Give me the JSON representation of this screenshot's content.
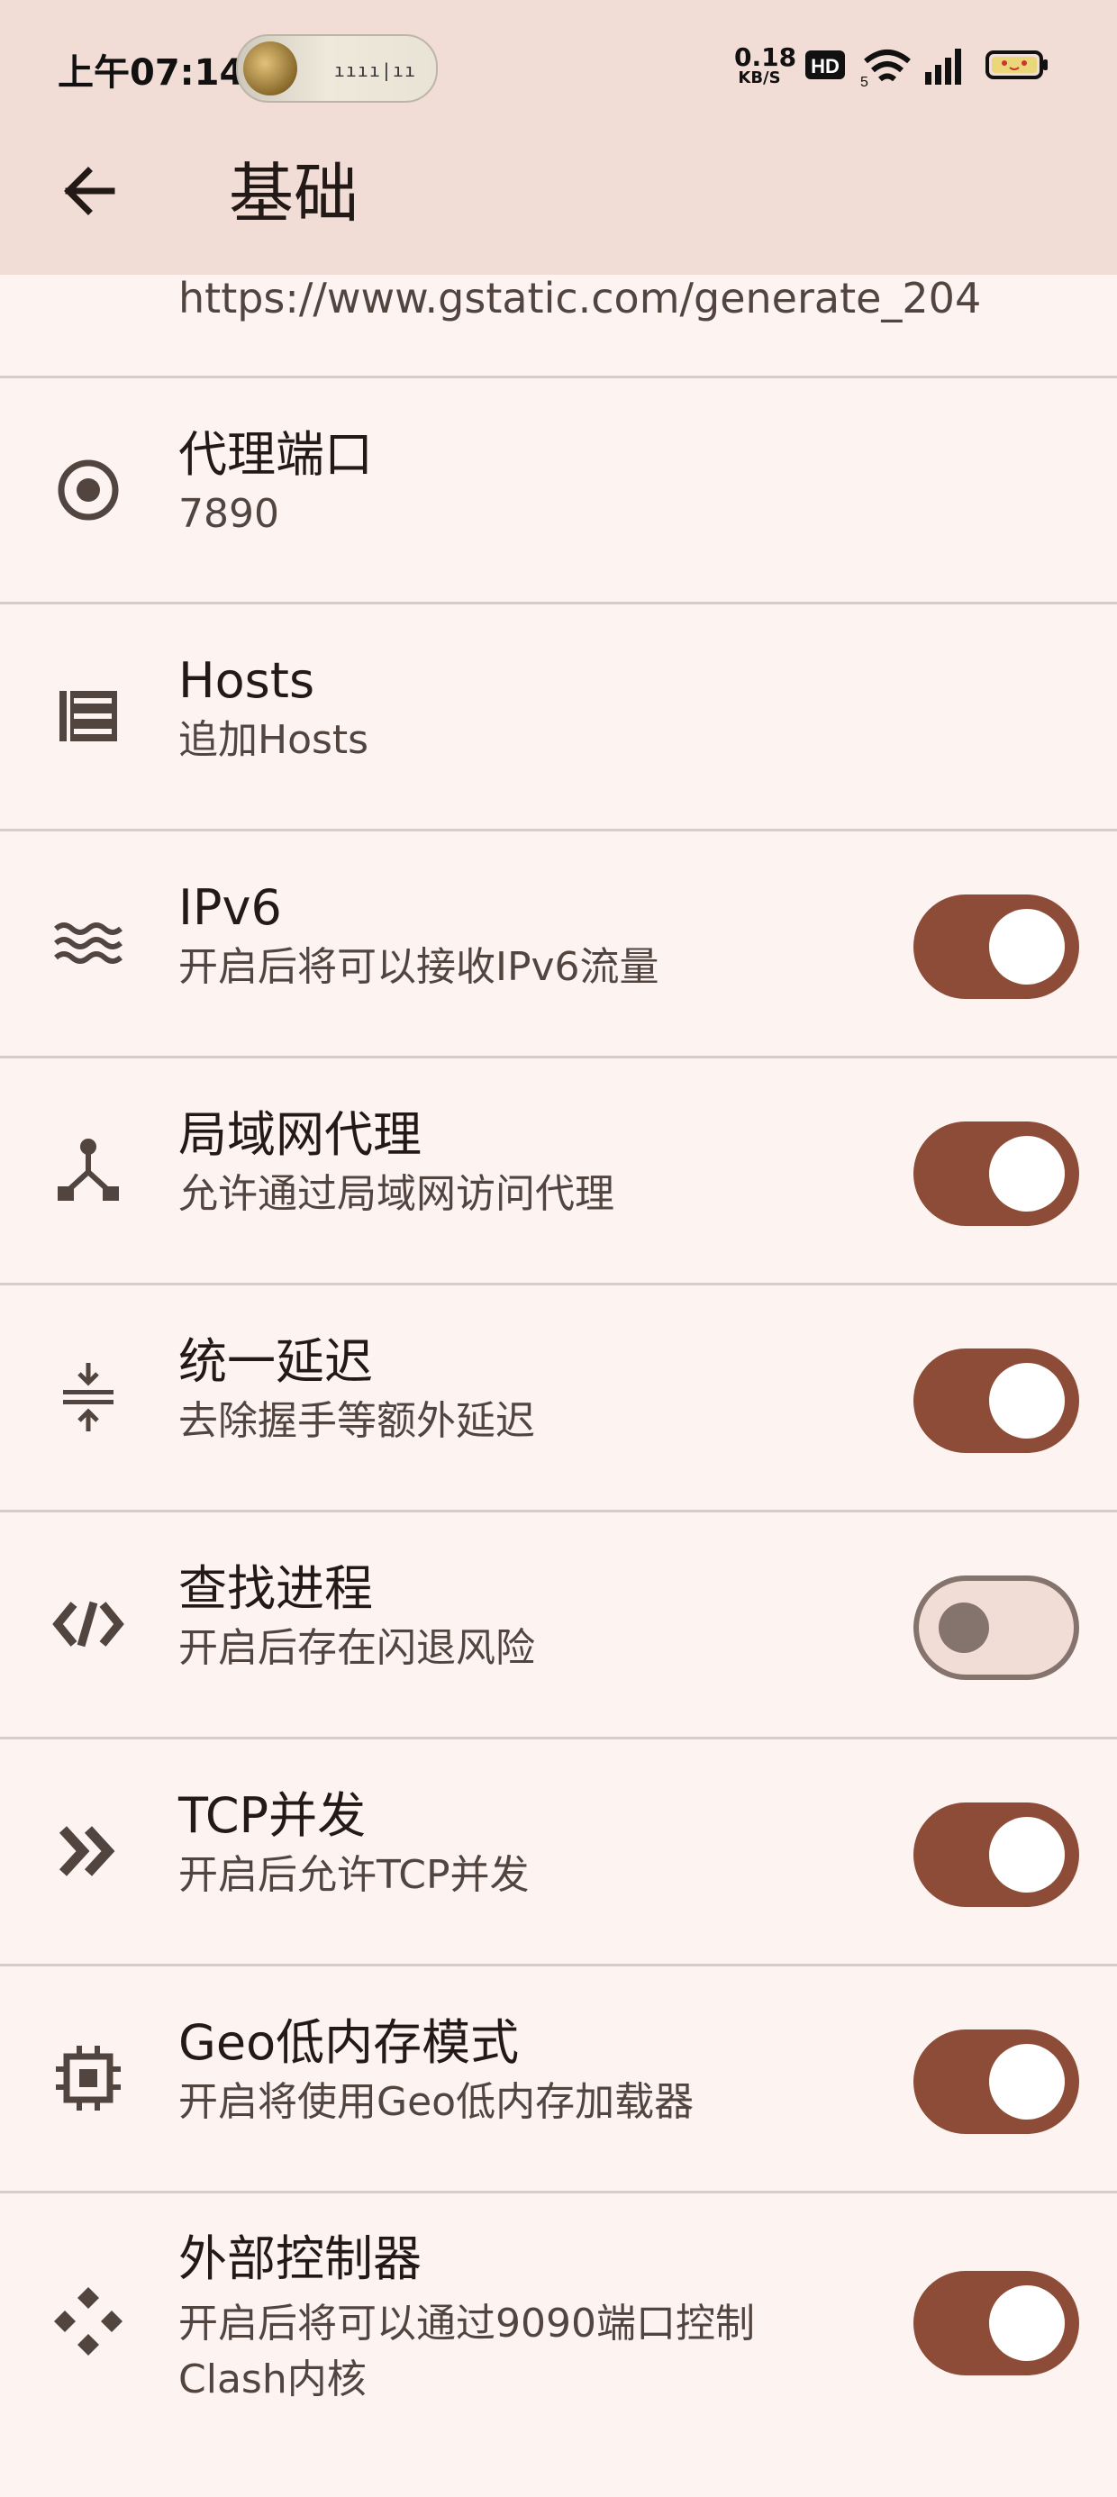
{
  "status_bar": {
    "time": "上午07:14",
    "net_speed_value": "0.18",
    "net_speed_unit": "KB/S",
    "icons": [
      "hd-icon",
      "wifi-icon",
      "signal-icon",
      "battery-icon"
    ]
  },
  "app_bar": {
    "title": "基础",
    "back_icon": "arrow-left-icon"
  },
  "top_partial_row": {
    "subtitle": "https://www.gstatic.com/generate_204"
  },
  "items": [
    {
      "icon": "radio-target-icon",
      "title": "代理端口",
      "subtitle": "7890"
    },
    {
      "icon": "list-icon",
      "title": "Hosts",
      "subtitle": "追加Hosts"
    },
    {
      "icon": "waves-icon",
      "title": "IPv6",
      "subtitle": "开启后将可以接收IPv6流量",
      "toggle": true
    },
    {
      "icon": "lan-icon",
      "title": "局域网代理",
      "subtitle": "允许通过局域网访问代理",
      "toggle": true
    },
    {
      "icon": "compress-icon",
      "title": "统一延迟",
      "subtitle": "去除握手等额外延迟",
      "toggle": true
    },
    {
      "icon": "code-icon",
      "title": "查找进程",
      "subtitle": "开启后存在闪退风险",
      "toggle": false
    },
    {
      "icon": "double-chevron-right-icon",
      "title": "TCP并发",
      "subtitle": "开启后允许TCP并发",
      "toggle": true
    },
    {
      "icon": "memory-chip-icon",
      "title": "Geo低内存模式",
      "subtitle": "开启将使用Geo低内存加载器",
      "toggle": true
    },
    {
      "icon": "controller-icon",
      "title": "外部控制器",
      "subtitle": "开启后将可以通过9090端口控制",
      "subtitle2": "Clash内核",
      "toggle": true
    }
  ],
  "colors": {
    "accent": "#8c4c37",
    "background": "#fdf3f0",
    "app_bar": "#f2ddd6"
  }
}
